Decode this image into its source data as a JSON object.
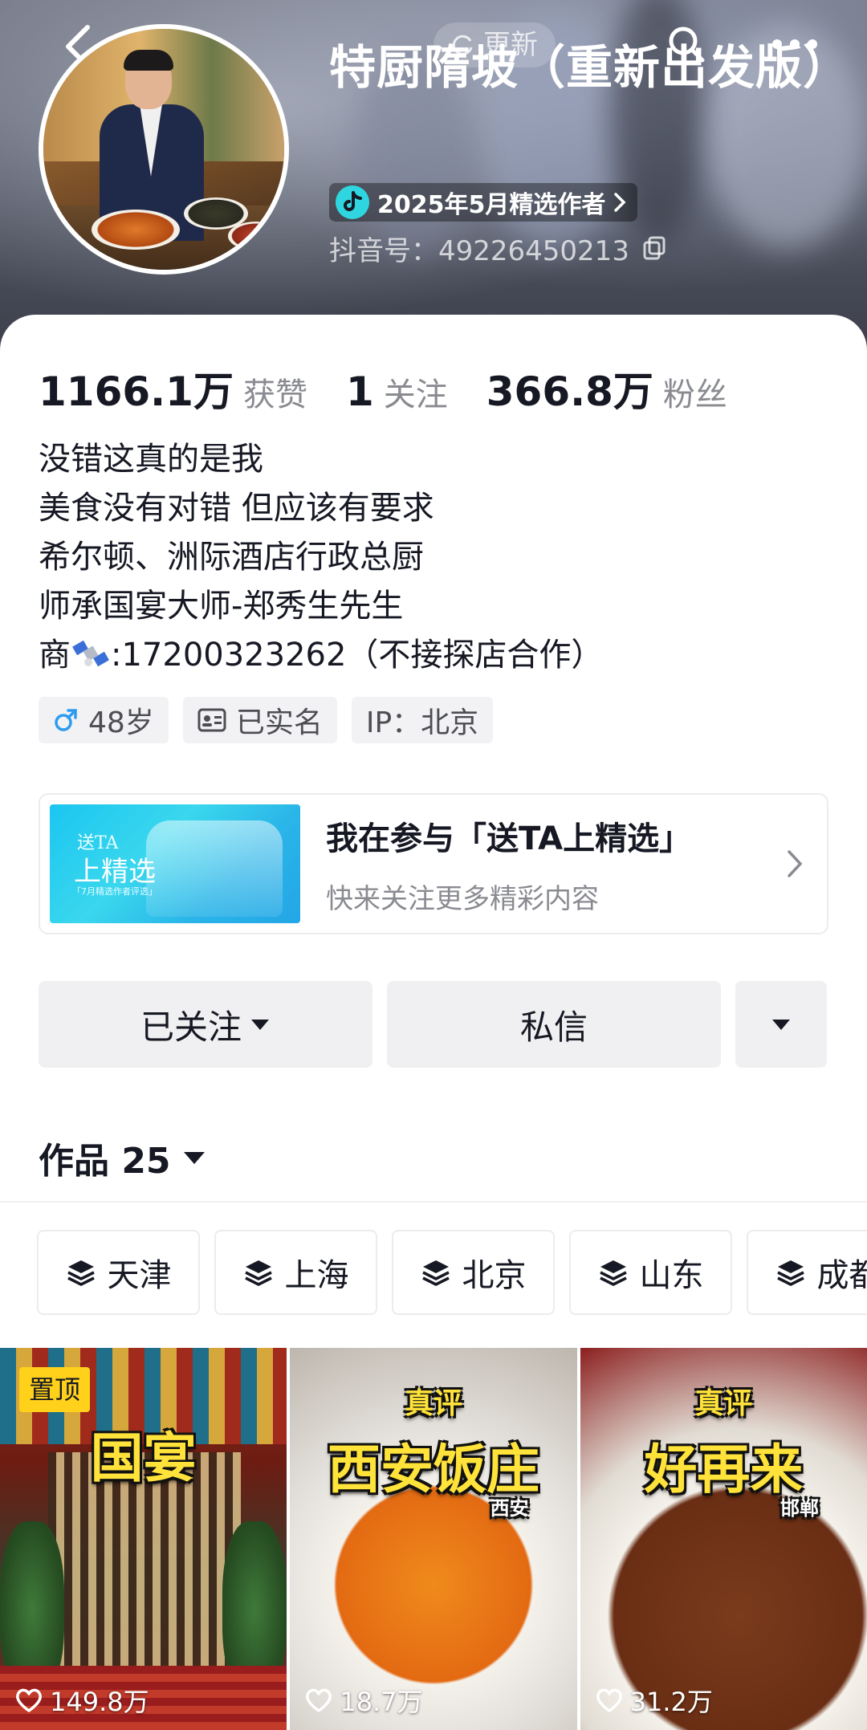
{
  "header": {
    "hint_text": "更新",
    "title": "特厨隋坡（重新出发版）",
    "badge": "2025年5月精选作者",
    "douyin_id_label": "抖音号：",
    "douyin_id": "49226450213"
  },
  "stats": [
    {
      "value": "1166.1万",
      "label": "获赞"
    },
    {
      "value": "1",
      "label": "关注"
    },
    {
      "value": "366.8万",
      "label": "粉丝"
    }
  ],
  "bio": [
    "没错这真的是我",
    "美食没有对错 但应该有要求",
    "希尔顿、洲际酒店行政总厨",
    "师承国宴大师-郑秀生先生"
  ],
  "bio_contact": {
    "prefix": "商",
    "number": ":17200323262（不接探店合作）"
  },
  "tags": {
    "age": "48岁",
    "verified": "已实名",
    "ip": "IP：北京"
  },
  "promo": {
    "title": "我在参与「送TA上精选」",
    "subtitle": "快来关注更多精彩内容",
    "image_line1": "送TA",
    "image_line2": "上精选",
    "image_line3": "「7月精选作者评选」"
  },
  "actions": {
    "follow": "已关注",
    "message": "私信"
  },
  "works": {
    "label": "作品 25"
  },
  "chips": [
    "天津",
    "上海",
    "北京",
    "山东",
    "成都"
  ],
  "videos": [
    {
      "pinned_label": "置顶",
      "caption": "国宴",
      "likes": "149.8万"
    },
    {
      "top": "真评",
      "caption": "西安饭庄",
      "city": "西安",
      "likes": "18.7万"
    },
    {
      "top": "真评",
      "caption": "好再来",
      "city": "邯郸",
      "likes": "31.2万"
    }
  ],
  "colors": {
    "accent_yellow": "#ffd11a",
    "text": "#161823",
    "muted": "#8a8b91",
    "badge_cyan": "#2fd6e0"
  }
}
